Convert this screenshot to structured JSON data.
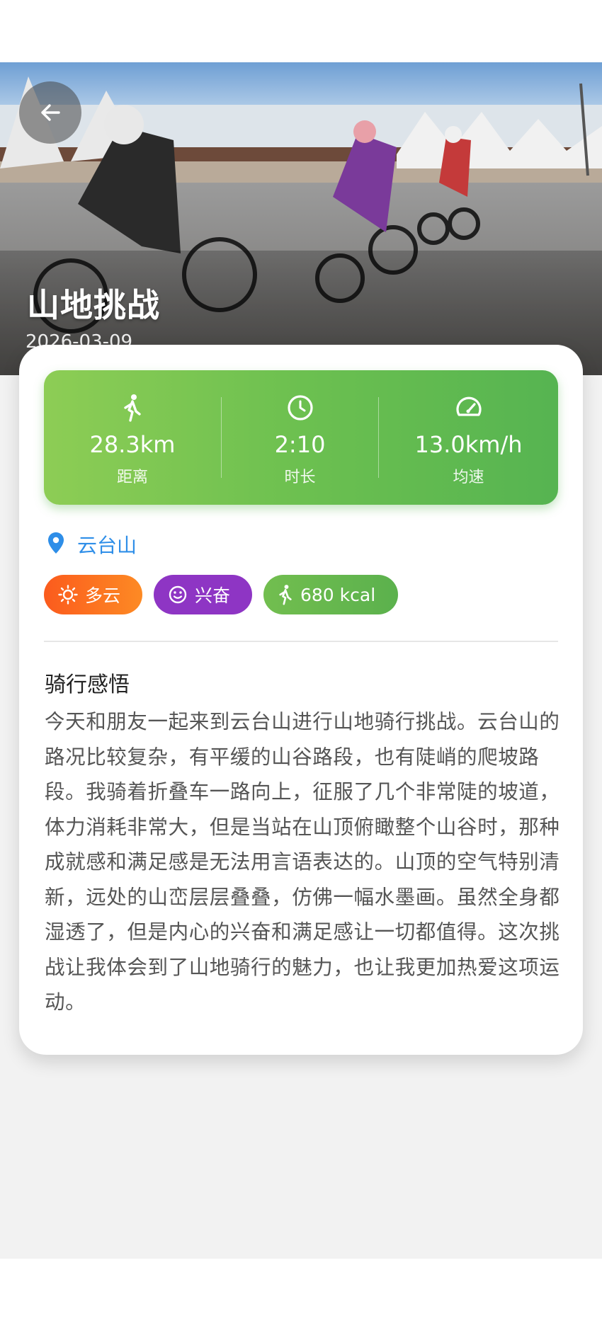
{
  "trip": {
    "title": "山地挑战",
    "date": "2026-03-09"
  },
  "stats": {
    "distance": {
      "icon": "walking-icon",
      "value": "28.3km",
      "label": "距离"
    },
    "duration": {
      "icon": "clock-icon",
      "value": "2:10",
      "label": "时长"
    },
    "speed": {
      "icon": "speedometer-icon",
      "value": "13.0km/h",
      "label": "均速"
    }
  },
  "location": {
    "icon": "location-pin-icon",
    "name": "云台山"
  },
  "tags": [
    {
      "icon": "sun-icon",
      "label": "多云",
      "color": "#fb6a1e"
    },
    {
      "icon": "smile-icon",
      "label": "兴奋",
      "color": "#8e35c4"
    },
    {
      "icon": "walking-icon",
      "label": "680 kcal",
      "color": "#61b64e"
    }
  ],
  "reflection": {
    "title": "骑行感悟",
    "text": "今天和朋友一起来到云台山进行山地骑行挑战。云台山的路况比较复杂，有平缓的山谷路段，也有陡峭的爬坡路段。我骑着折叠车一路向上，征服了几个非常陡的坡道，体力消耗非常大，但是当站在山顶俯瞰整个山谷时，那种成就感和满足感是无法用言语表达的。山顶的空气特别清新，远处的山峦层层叠叠，仿佛一幅水墨画。虽然全身都湿透了，但是内心的兴奋和满足感让一切都值得。这次挑战让我体会到了山地骑行的魅力，也让我更加热爱这项运动。"
  },
  "colors": {
    "stats_gradient_start": "#8dcd55",
    "stats_gradient_end": "#56b451",
    "location": "#2e8ee8"
  }
}
